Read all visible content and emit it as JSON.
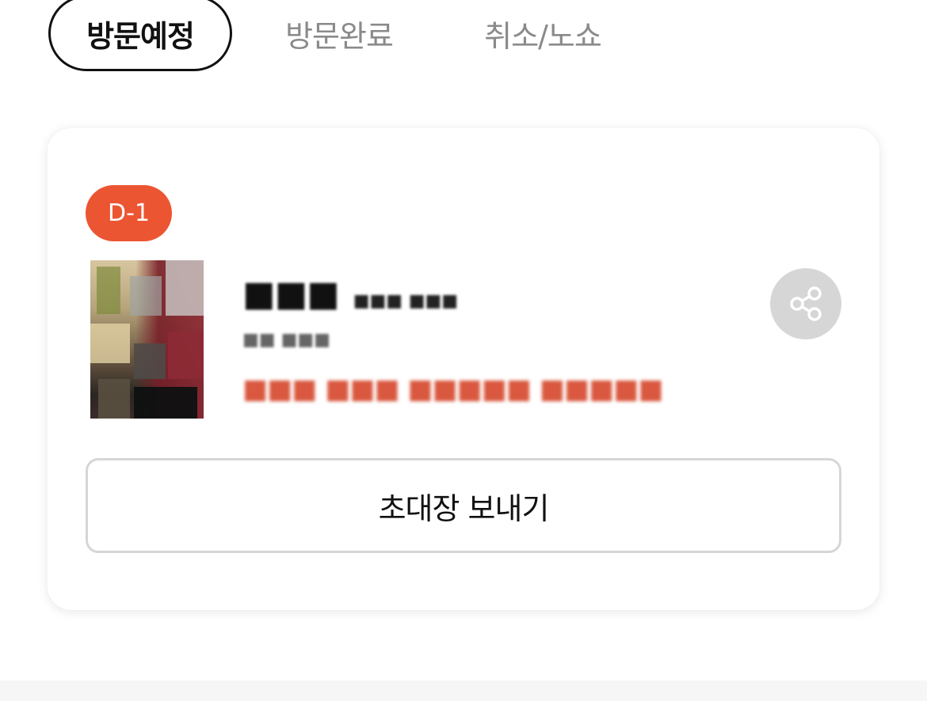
{
  "tabs": [
    {
      "label": "방문예정",
      "active": true
    },
    {
      "label": "방문완료",
      "active": false
    },
    {
      "label": "취소/노쇼",
      "active": false
    }
  ],
  "reservation": {
    "dday": "D-1",
    "restaurant_name": "■■■",
    "restaurant_sub": "■■■ ■■■",
    "meta": "■■ ■■■",
    "notice": "■■■ ■■■ ■■■■■ ■■■■■",
    "share_icon": "share-icon",
    "invite_label": "초대장 보내기"
  },
  "colors": {
    "accent": "#ec5532",
    "share_bg": "#d6d6d6",
    "border": "#d6d6d6"
  }
}
